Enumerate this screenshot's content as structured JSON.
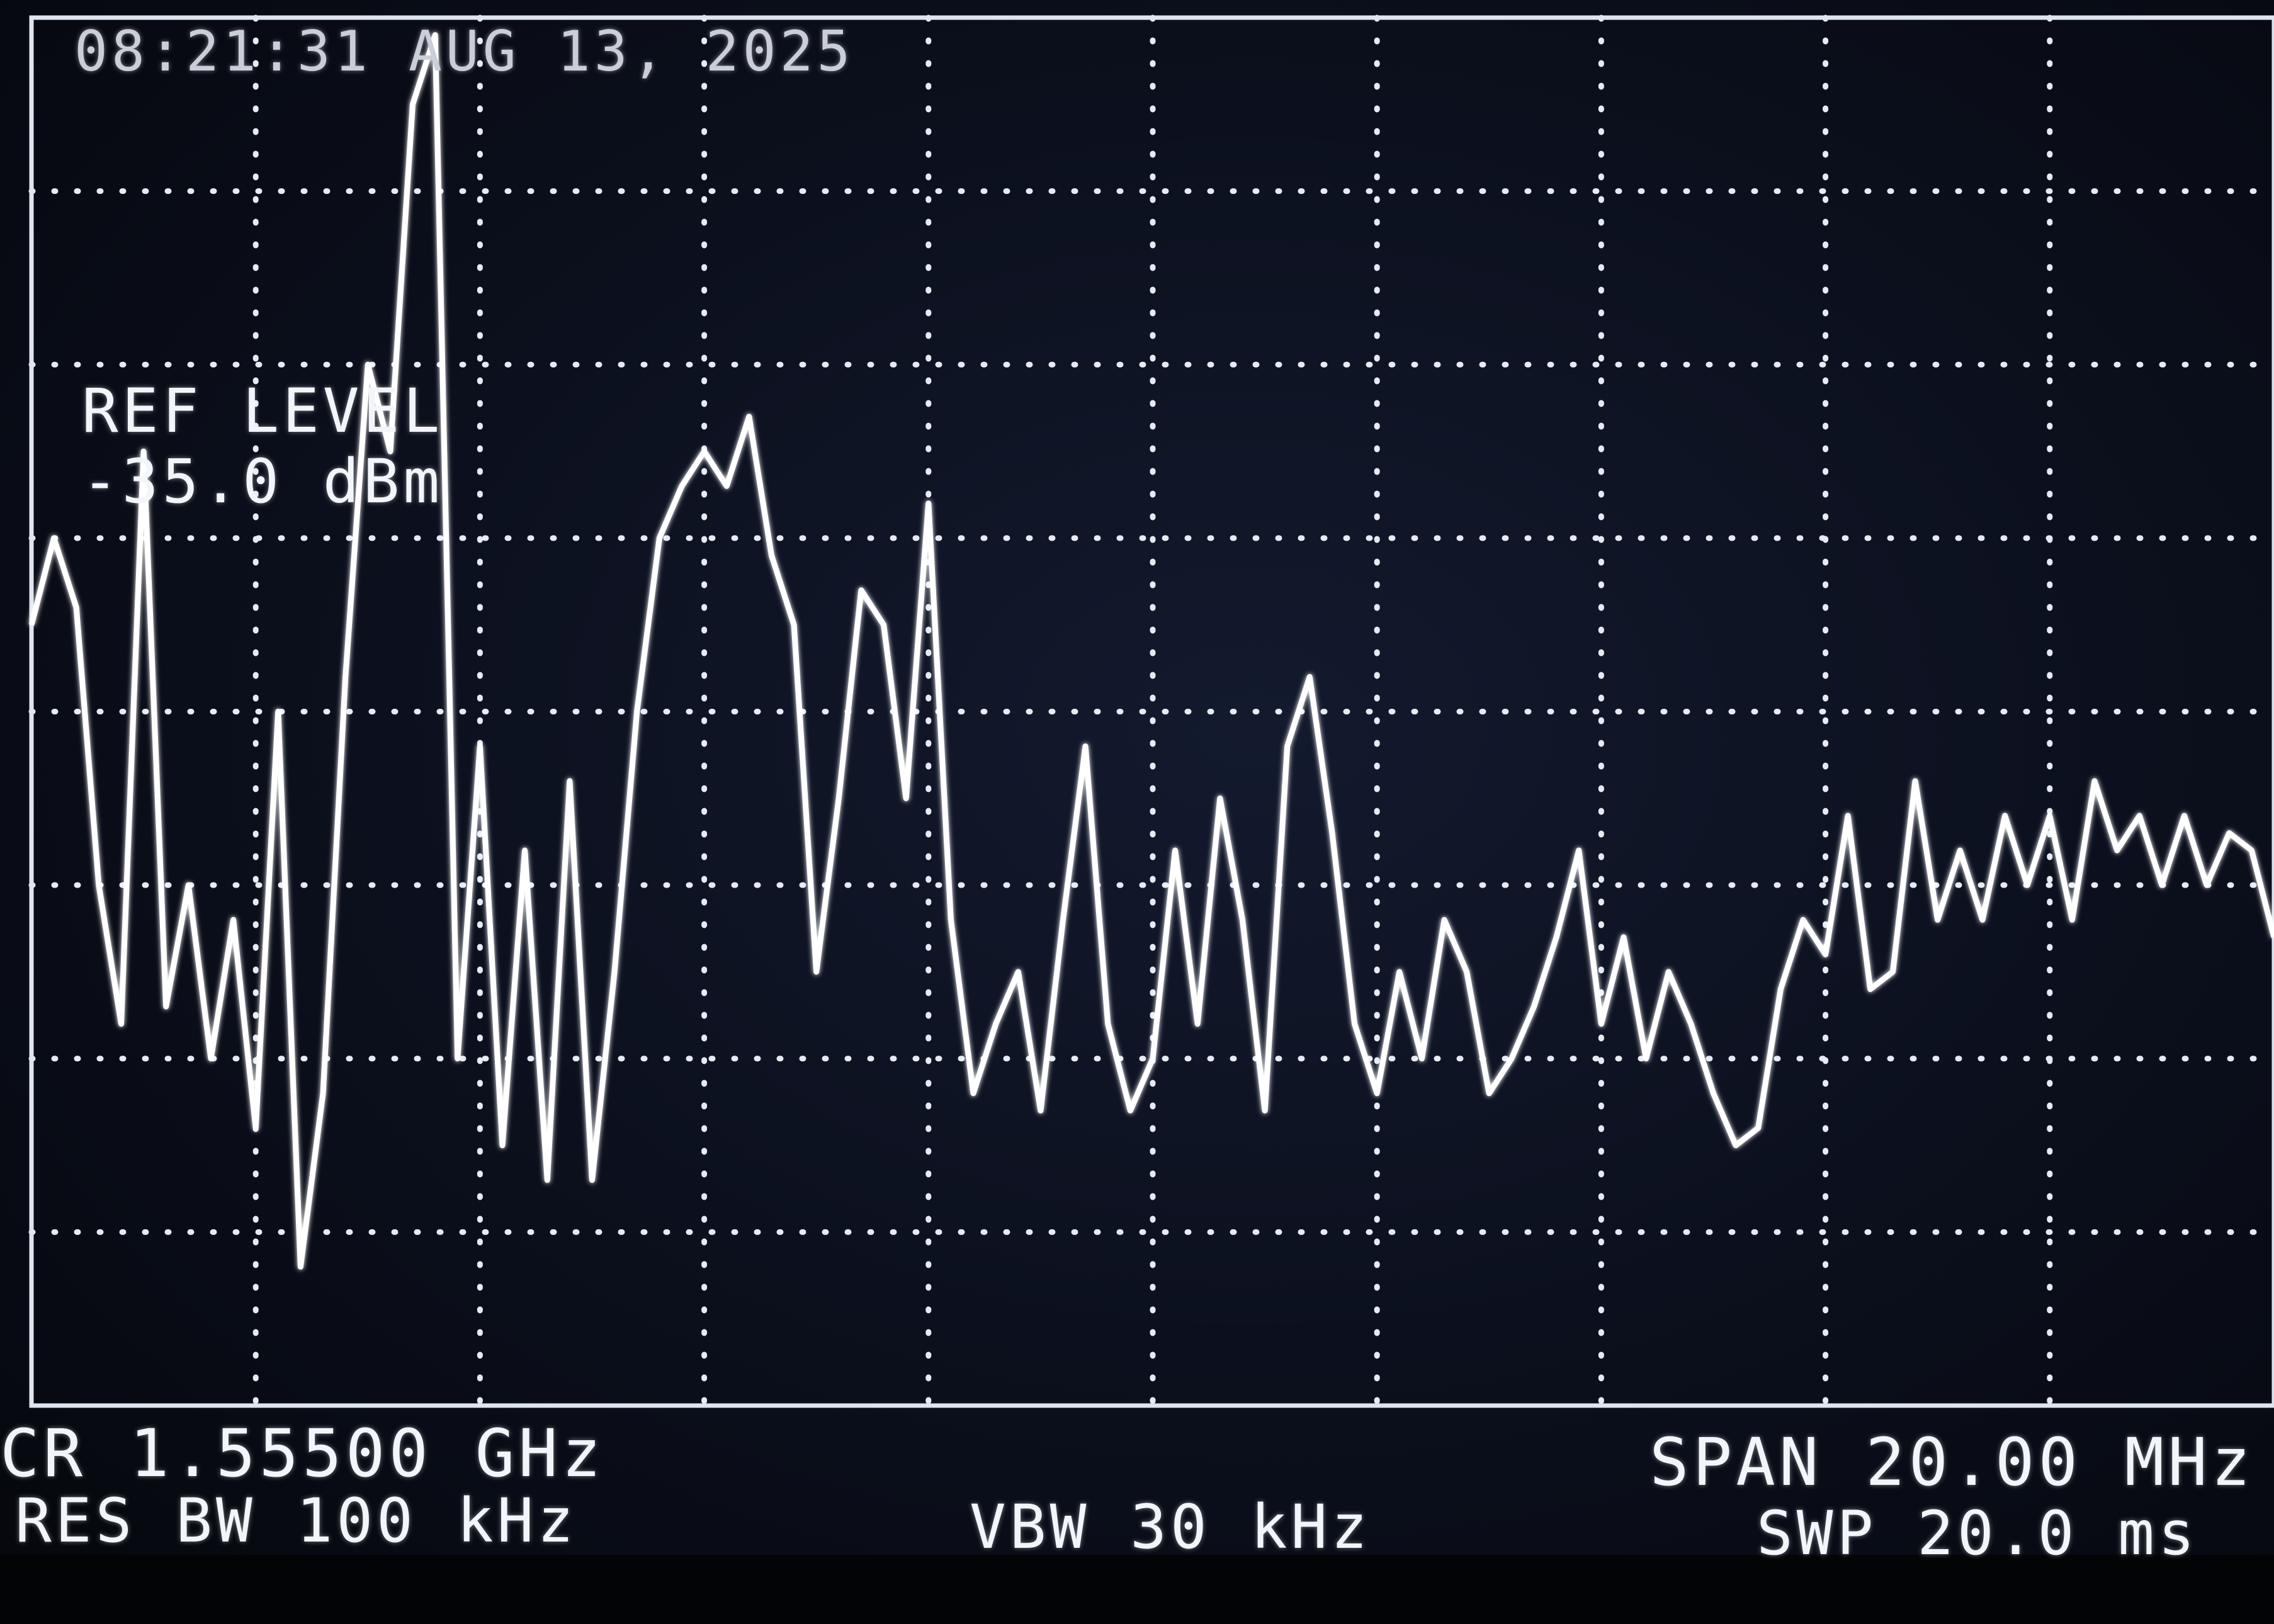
{
  "header": {
    "timestamp": "08:21:31 AUG 13, 2025"
  },
  "ref": {
    "label": "REF LEVEL",
    "value": "-35.0 dBm"
  },
  "footer": {
    "center_freq": "CR 1.55500 GHz",
    "res_bw": "RES BW 100 kHz",
    "vbw": "VBW 30 kHz",
    "span": "SPAN 20.00 MHz",
    "sweep": "SWP 20.0 ms"
  },
  "colors": {
    "trace": "#ffffff",
    "grid": "#e6ebf3",
    "background": "#0b0f1c"
  },
  "chart_data": {
    "type": "line",
    "title": "",
    "xlabel": "",
    "ylabel": "",
    "center_freq_ghz": 1.555,
    "span_mhz": 20.0,
    "ref_level_dbm": -35.0,
    "divisions_x": 10,
    "divisions_y": 8,
    "grid": true,
    "units": {
      "x": "MHz (offset from center)",
      "y": "dB below reference"
    },
    "ylim": [
      -80,
      0
    ],
    "xlim": [
      -10,
      10
    ],
    "x": [
      -10.0,
      -9.8,
      -9.6,
      -9.4,
      -9.2,
      -9.0,
      -8.8,
      -8.6,
      -8.4,
      -8.2,
      -8.0,
      -7.8,
      -7.6,
      -7.4,
      -7.2,
      -7.0,
      -6.8,
      -6.6,
      -6.4,
      -6.2,
      -6.0,
      -5.8,
      -5.6,
      -5.4,
      -5.2,
      -5.0,
      -4.8,
      -4.6,
      -4.4,
      -4.2,
      -4.0,
      -3.8,
      -3.6,
      -3.4,
      -3.2,
      -3.0,
      -2.8,
      -2.6,
      -2.4,
      -2.2,
      -2.0,
      -1.8,
      -1.6,
      -1.4,
      -1.2,
      -1.0,
      -0.8,
      -0.6,
      -0.4,
      -0.2,
      0.0,
      0.2,
      0.4,
      0.6,
      0.8,
      1.0,
      1.2,
      1.4,
      1.6,
      1.8,
      2.0,
      2.2,
      2.4,
      2.6,
      2.8,
      3.0,
      3.2,
      3.4,
      3.6,
      3.8,
      4.0,
      4.2,
      4.4,
      4.6,
      4.8,
      5.0,
      5.2,
      5.4,
      5.6,
      5.8,
      6.0,
      6.2,
      6.4,
      6.6,
      6.8,
      7.0,
      7.2,
      7.4,
      7.6,
      7.8,
      8.0,
      8.2,
      8.4,
      8.6,
      8.8,
      9.0,
      9.2,
      9.4,
      9.6,
      9.8,
      10.0
    ],
    "y": [
      -35,
      -30,
      -34,
      -50,
      -58,
      -25,
      -57,
      -50,
      -60,
      -52,
      -64,
      -40,
      -72,
      -62,
      -38,
      -20,
      -25,
      -5,
      -1,
      -60,
      -42,
      -65,
      -48,
      -67,
      -44,
      -67,
      -55,
      -40,
      -30,
      -27,
      -25,
      -27,
      -23,
      -31,
      -35,
      -55,
      -45,
      -33,
      -35,
      -45,
      -28,
      -52,
      -62,
      -58,
      -55,
      -63,
      -52,
      -42,
      -58,
      -63,
      -60,
      -48,
      -58,
      -45,
      -52,
      -63,
      -42,
      -38,
      -47,
      -58,
      -62,
      -55,
      -60,
      -52,
      -55,
      -62,
      -60,
      -57,
      -53,
      -48,
      -58,
      -53,
      -60,
      -55,
      -58,
      -62,
      -65,
      -64,
      -56,
      -52,
      -54,
      -46,
      -56,
      -55,
      -44,
      -52,
      -48,
      -52,
      -46,
      -50,
      -46,
      -52,
      -44,
      -48,
      -46,
      -50,
      -46,
      -50,
      -47,
      -48,
      -53
    ]
  }
}
